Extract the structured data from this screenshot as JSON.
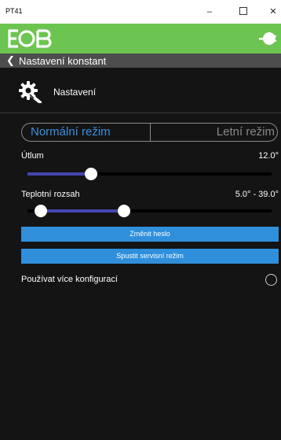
{
  "window": {
    "title": "PT41",
    "minimize_label": "–",
    "close_label": "✕"
  },
  "nav": {
    "title": "Nastavení konstant"
  },
  "section": {
    "title": "Nastavení"
  },
  "mode_toggle": {
    "options": [
      "Normální režim",
      "Letní režim"
    ],
    "selected": "Normální režim"
  },
  "utlum": {
    "label": "Útlum",
    "value_text": "12.0°",
    "slider_fraction": 0.262
  },
  "teplotni_rozsah": {
    "label": "Teplotní rozsah",
    "value_text": "5.0° - 39.0°",
    "slider_low_fraction": 0.055,
    "slider_high_fraction": 0.395
  },
  "buttons": {
    "change_password": "Změnit heslo",
    "service_mode": "Spustit servisní režim"
  },
  "multi_config": {
    "label": "Používat více konfigurací",
    "checked": false
  },
  "colors": {
    "header_green": "#6cc551",
    "accent_blue": "#2f8fdb",
    "slider_fill": "#4545b0"
  }
}
